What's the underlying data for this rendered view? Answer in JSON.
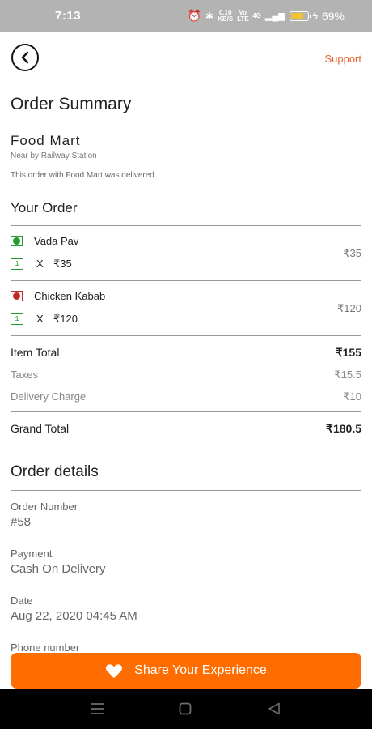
{
  "status_bar": {
    "time": "7:13",
    "net_speed": "0.10",
    "net_unit": "KB/S",
    "volte": "Vo LTE",
    "network": "4G",
    "battery_percent": "69%"
  },
  "header": {
    "support_label": "Support"
  },
  "page_title": "Order Summary",
  "store": {
    "name": "Food Mart",
    "location": "Near by Railway Station",
    "status_text": "This order with Food Mart was delivered"
  },
  "your_order": {
    "title": "Your Order",
    "items": [
      {
        "name": "Vada Pav",
        "type": "veg",
        "qty": "1",
        "x": "X",
        "unit_price": "₹35",
        "price": "₹35"
      },
      {
        "name": "Chicken Kabab",
        "type": "non-veg",
        "qty": "1",
        "x": "X",
        "unit_price": "₹120",
        "price": "₹120"
      }
    ]
  },
  "bill": {
    "item_total_label": "Item Total",
    "item_total_value": "₹155",
    "taxes_label": "Taxes",
    "taxes_value": "₹15.5",
    "delivery_label": "Delivery Charge",
    "delivery_value": "₹10",
    "grand_total_label": "Grand Total",
    "grand_total_value": "₹180.5"
  },
  "order_details": {
    "title": "Order details",
    "order_number_label": "Order Number",
    "order_number": "#58",
    "payment_label": "Payment",
    "payment": "Cash On Delivery",
    "date_label": "Date",
    "date": "Aug 22, 2020 04:45 AM",
    "phone_label": "Phone number"
  },
  "cta": {
    "label": "Share Your Experience"
  },
  "colors": {
    "accent": "#ff6c00",
    "support": "#e8612c",
    "veg": "#1f9d2c",
    "non_veg": "#c62828"
  }
}
